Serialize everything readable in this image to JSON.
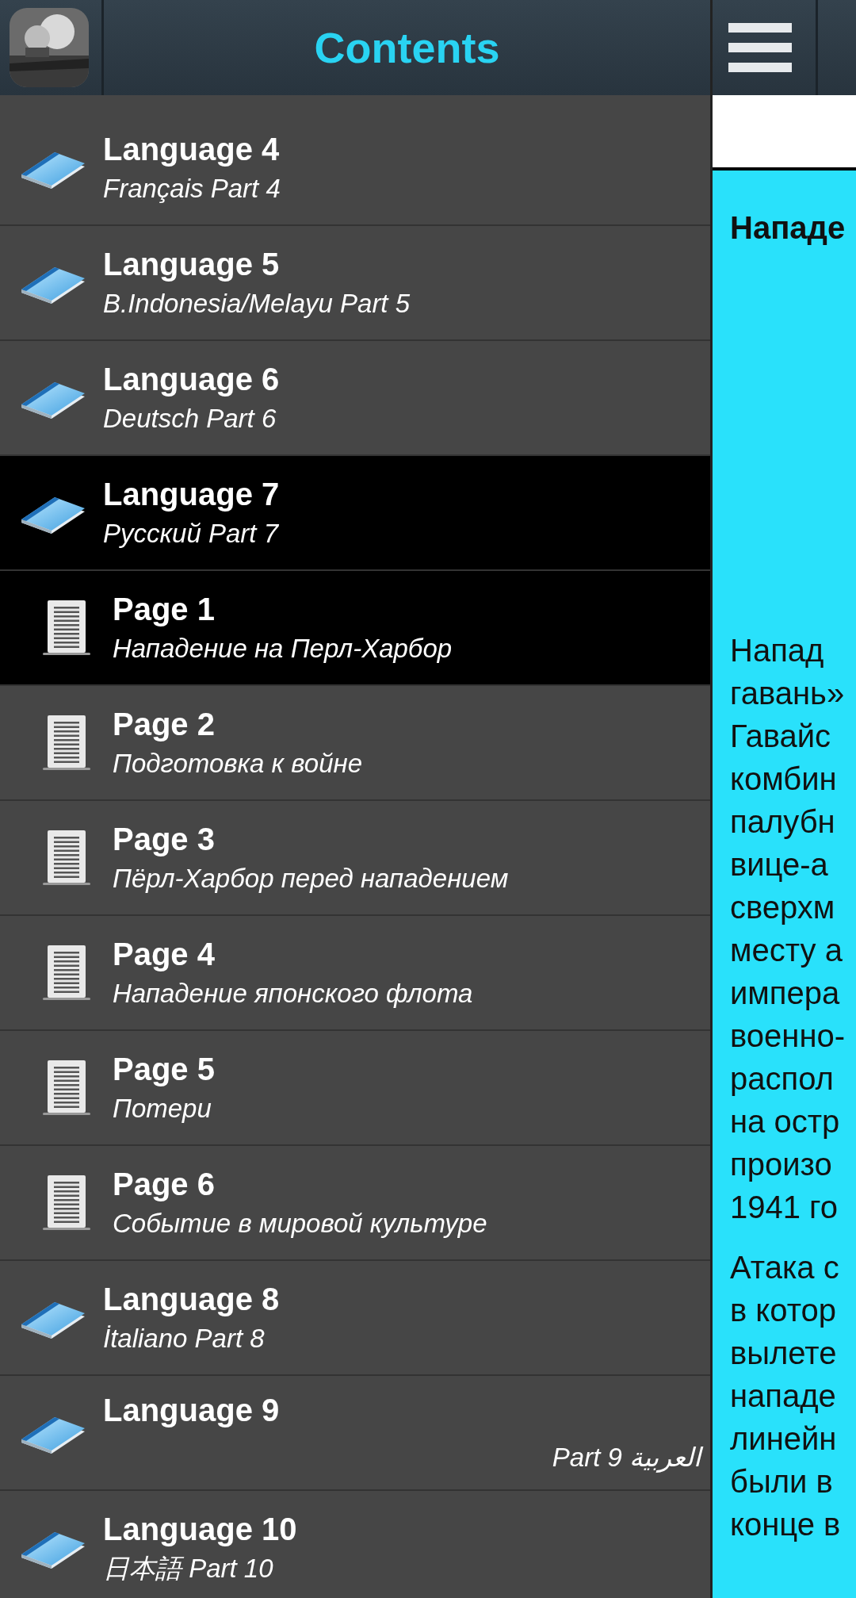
{
  "header": {
    "title": "Contents"
  },
  "items": [
    {
      "kind": "language",
      "title": "Language 4",
      "subtitle": "Français Part 4",
      "selected": false,
      "rtl": false
    },
    {
      "kind": "language",
      "title": "Language 5",
      "subtitle": "B.Indonesia/Melayu Part 5",
      "selected": false,
      "rtl": false
    },
    {
      "kind": "language",
      "title": "Language 6",
      "subtitle": "Deutsch Part 6",
      "selected": false,
      "rtl": false
    },
    {
      "kind": "language",
      "title": "Language 7",
      "subtitle": "Русский Part 7",
      "selected": true,
      "rtl": false,
      "children": [
        {
          "kind": "page",
          "title": "Page 1",
          "subtitle": "Нападение на Перл-Харбор",
          "selected": true,
          "rtl": false
        },
        {
          "kind": "page",
          "title": "Page 2",
          "subtitle": "Подготовка к войне",
          "selected": false,
          "rtl": false
        },
        {
          "kind": "page",
          "title": "Page 3",
          "subtitle": "Пёрл-Харбор перед нападением",
          "selected": false,
          "rtl": false
        },
        {
          "kind": "page",
          "title": "Page 4",
          "subtitle": "Нападение японского флота",
          "selected": false,
          "rtl": false
        },
        {
          "kind": "page",
          "title": "Page 5",
          "subtitle": "Потери",
          "selected": false,
          "rtl": false
        },
        {
          "kind": "page",
          "title": "Page 6",
          "subtitle": "Событие в мировой культуре",
          "selected": false,
          "rtl": false
        }
      ]
    },
    {
      "kind": "language",
      "title": "Language 8",
      "subtitle": "İtaliano Part 8",
      "selected": false,
      "rtl": false
    },
    {
      "kind": "language",
      "title": "Language 9",
      "subtitle": "العربية Part 9",
      "selected": false,
      "rtl": true
    },
    {
      "kind": "language",
      "title": "Language 10",
      "subtitle": "日本語 Part 10",
      "selected": false,
      "rtl": false
    }
  ],
  "article": {
    "heading": "Нападе",
    "paragraphs": [
      [
        "Напад",
        "гавань»",
        "Гавайс",
        "комбин",
        "палубн",
        "вице-а",
        "сверхм",
        "месту а",
        "импера",
        "военно-",
        "распол",
        "на остр",
        "произо",
        "1941 го"
      ],
      [
        "Атака с",
        "в котор",
        "вылете",
        "нападе",
        "линейн",
        "были в",
        "конце в"
      ]
    ]
  }
}
